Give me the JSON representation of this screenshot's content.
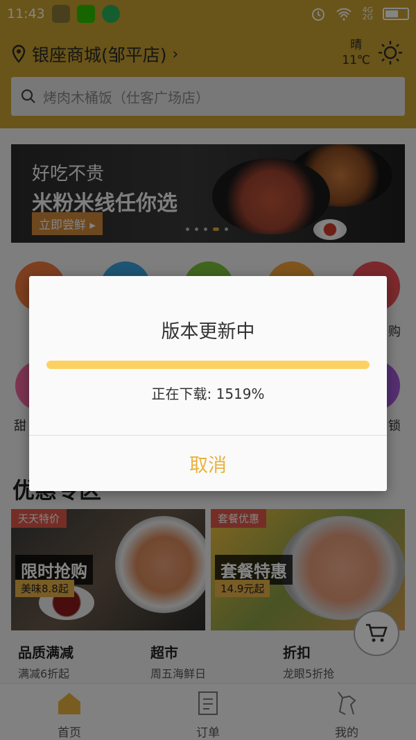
{
  "status_bar": {
    "time": "11:43",
    "network_labels": [
      "4G",
      "2G"
    ],
    "battery_percent": 60
  },
  "header": {
    "location": "银座商城(邹平店)",
    "weather_condition": "晴",
    "temperature": "11℃",
    "search_placeholder": "烤肉木桶饭（仕客广场店）"
  },
  "banner": {
    "line1": "好吃不贵",
    "line2": "米粉米线任你选",
    "button": "立即尝鲜",
    "slides": 5,
    "active_slide": 4
  },
  "categories": {
    "row2_partial_labels": [
      "甜",
      "锁"
    ],
    "row1_partial_label": "购"
  },
  "section": {
    "title": "优惠专区"
  },
  "promos": [
    {
      "tag": "天天特价",
      "title": "限时抢购",
      "price": "美味8.8起"
    },
    {
      "tag": "套餐优惠",
      "title": "套餐特惠",
      "price": "14.9元起"
    }
  ],
  "mini_cards": [
    {
      "title": "品质满减",
      "subtitle": "满减6折起"
    },
    {
      "title": "超市",
      "subtitle": "周五海鲜日"
    },
    {
      "title": "折扣",
      "subtitle": "龙眼5折抢"
    }
  ],
  "tabs": [
    {
      "label": "首页",
      "active": true
    },
    {
      "label": "订单",
      "active": false
    },
    {
      "label": "我的",
      "active": false
    }
  ],
  "dialog": {
    "title": "版本更新中",
    "status": "正在下载: 1519%",
    "progress_fraction": 1.0,
    "cancel": "取消"
  },
  "colors": {
    "header": "#c9a130",
    "accent": "#e9b23e",
    "progress": "#fbd262"
  }
}
